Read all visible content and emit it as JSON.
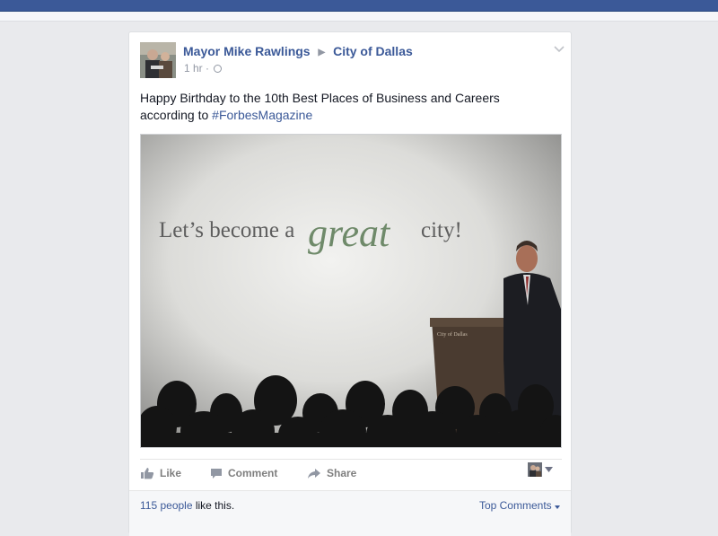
{
  "post": {
    "author": "Mayor Mike Rawlings",
    "target": "City of Dallas",
    "time": "1 hr",
    "time_separator": "·",
    "text": "Happy Birthday to the 10th Best Places of Business and Careers according to ",
    "hashtag": "#ForbesMagazine",
    "photo": {
      "banner_prefix": "Let’s become a",
      "banner_emphasis": "great",
      "banner_suffix": "city!",
      "podium_text": "City of Dallas"
    }
  },
  "actions": {
    "like_label": "Like",
    "comment_label": "Comment",
    "share_label": "Share"
  },
  "likes": {
    "count_text": "115 people",
    "suffix": " like this.",
    "top_comments_label": "Top Comments"
  },
  "colors": {
    "facebook_blue": "#3b5998",
    "page_bg": "#e9eaed"
  }
}
